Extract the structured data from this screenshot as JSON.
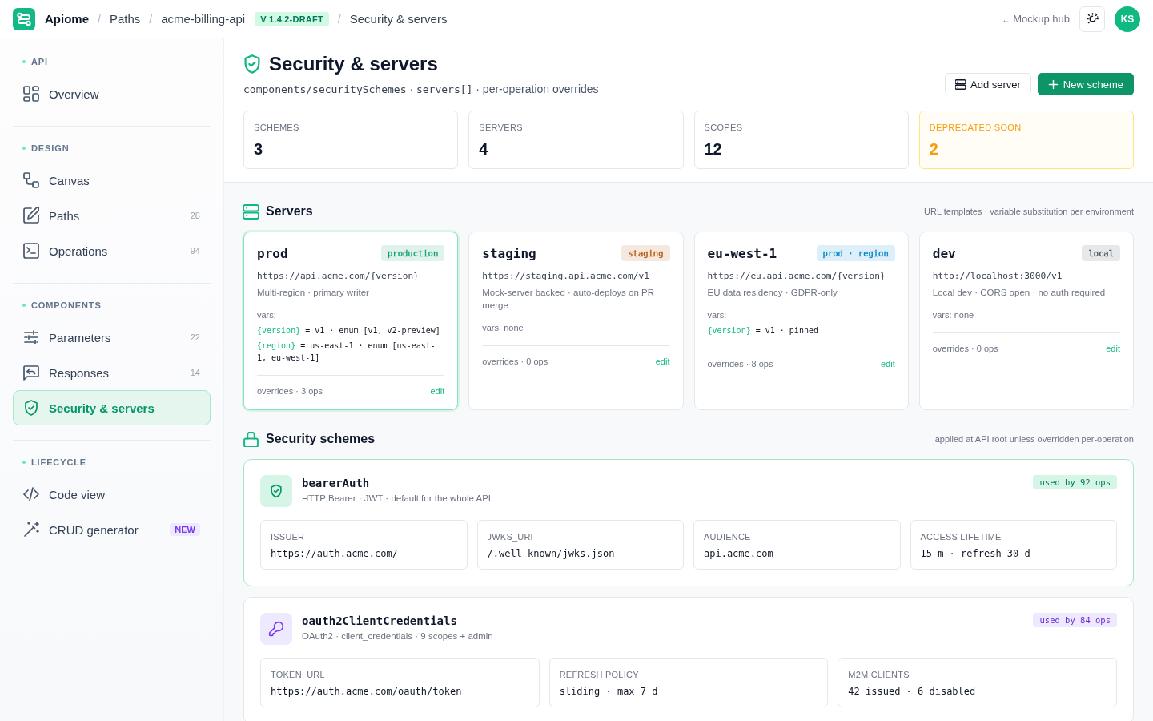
{
  "topbar": {
    "breadcrumb": [
      {
        "kind": "brand",
        "label": "Apiome"
      },
      {
        "kind": "separator",
        "label": "/"
      },
      {
        "kind": "link",
        "label": "Paths"
      },
      {
        "kind": "separator",
        "label": "/"
      },
      {
        "kind": "link",
        "label": "acme-billing-api"
      },
      {
        "kind": "badge",
        "label": "V 1.4.2-DRAFT"
      },
      {
        "kind": "separator",
        "label": "/"
      },
      {
        "kind": "current",
        "label": "Security & servers"
      }
    ],
    "back_link": {
      "arrow": "←",
      "label": "Mockup hub"
    },
    "avatar": "KS"
  },
  "sidebar": {
    "sections": [
      {
        "label": "API",
        "items": [
          {
            "label": "Overview",
            "kind": "dashboard",
            "selected": false
          }
        ]
      },
      {
        "label": "DESIGN",
        "items": [
          {
            "label": "Canvas",
            "kind": "canvas",
            "selected": false
          },
          {
            "label": "Paths",
            "kind": "edit",
            "count": "28",
            "selected": false
          },
          {
            "label": "Operations",
            "kind": "terminal",
            "count": "94",
            "selected": false
          }
        ]
      },
      {
        "label": "COMPONENTS",
        "items": [
          {
            "label": "Parameters",
            "kind": "sliders",
            "count": "22",
            "selected": false
          },
          {
            "label": "Responses",
            "kind": "reply",
            "count": "14",
            "selected": false
          },
          {
            "label": "Security & servers",
            "kind": "shield",
            "selected": true
          }
        ]
      },
      {
        "label": "LIFECYCLE",
        "items": [
          {
            "label": "Code view",
            "kind": "code",
            "selected": false
          },
          {
            "label": "CRUD generator",
            "kind": "wand",
            "badge": "NEW",
            "selected": false
          }
        ]
      }
    ]
  },
  "header": {
    "title": "Security & servers",
    "subtitle": [
      {
        "kind": "code",
        "text": "components/securitySchemes"
      },
      {
        "kind": "text",
        "text": "·"
      },
      {
        "kind": "code",
        "text": "servers[]"
      },
      {
        "kind": "text",
        "text": "·"
      },
      {
        "kind": "text",
        "text": "per-operation overrides"
      }
    ],
    "actions": [
      {
        "kind": "secondary",
        "label": "Add server"
      },
      {
        "kind": "primary",
        "label": "New scheme"
      }
    ],
    "stats": [
      {
        "label": "SCHEMES",
        "value": "3",
        "kind": "normal"
      },
      {
        "label": "SERVERS",
        "value": "4",
        "kind": "normal"
      },
      {
        "label": "SCOPES",
        "value": "12",
        "kind": "normal"
      },
      {
        "label": "DEPRECATED SOON",
        "value": "2",
        "kind": "warning"
      }
    ]
  },
  "servers_section": {
    "title": "Servers",
    "note": "URL templates · variable substitution per environment",
    "servers": [
      {
        "name": "prod",
        "tag": {
          "label": "production",
          "color": "#0e9f6e"
        },
        "url": "https://api.acme.com/{version}",
        "description": "Multi-region · primary writer",
        "vars_label": "vars:",
        "vars": [
          {
            "name": "{version}",
            "value": "= v1 · enum [v1, v2-preview]"
          },
          {
            "name": "{region}",
            "value": "= us-east-1 · enum [us-east-1, eu-west-1]"
          }
        ],
        "overrides": "overrides · 3 ops",
        "action": "edit",
        "selected": true
      },
      {
        "name": "staging",
        "tag": {
          "label": "staging",
          "color": "#b45309"
        },
        "url": "https://staging.api.acme.com/v1",
        "description": "Mock-server backed · auto-deploys on PR merge",
        "vars_label": "vars: none",
        "overrides": "overrides · 0 ops",
        "action": "edit",
        "selected": false
      },
      {
        "name": "eu-west-1",
        "tag": {
          "label": "prod · region",
          "color": "#0284c7"
        },
        "url": "https://eu.api.acme.com/{version}",
        "description": "EU data residency · GDPR-only",
        "vars_label": "vars:",
        "vars": [
          {
            "name": "{version}",
            "value": "= v1 · pinned"
          }
        ],
        "overrides": "overrides · 8 ops",
        "action": "edit",
        "selected": false
      },
      {
        "name": "dev",
        "tag": {
          "label": "local",
          "color": "#4b5563"
        },
        "url": "http://localhost:3000/v1",
        "description": "Local dev · CORS open · no auth required",
        "vars_label": "vars: none",
        "overrides": "overrides · 0 ops",
        "action": "edit",
        "selected": false
      }
    ]
  },
  "schemes_section": {
    "title": "Security schemes",
    "note": "applied at API root unless overridden per-operation",
    "schemes": [
      {
        "name": "bearerAuth",
        "kind": "http",
        "description": "HTTP Bearer · JWT · default for the whole API",
        "usage": "used by 92 ops",
        "selected": true,
        "fields": [
          {
            "label": "ISSUER",
            "value": "https://auth.acme.com/"
          },
          {
            "label": "JWKS_URI",
            "value": "/.well-known/jwks.json"
          },
          {
            "label": "AUDIENCE",
            "value": "api.acme.com"
          },
          {
            "label": "ACCESS LIFETIME",
            "value": "15 m · refresh 30 d"
          }
        ]
      },
      {
        "name": "oauth2ClientCredentials",
        "kind": "oauth2",
        "description": "OAuth2 · client_credentials · 9 scopes + admin",
        "usage": "used by 84 ops",
        "selected": false,
        "fields": [
          {
            "label": "TOKEN_URL",
            "value": "https://auth.acme.com/oauth/token"
          },
          {
            "label": "REFRESH POLICY",
            "value": "sliding · max 7 d"
          },
          {
            "label": "M2M CLIENTS",
            "value": "42 issued · 6 disabled"
          }
        ]
      }
    ]
  }
}
